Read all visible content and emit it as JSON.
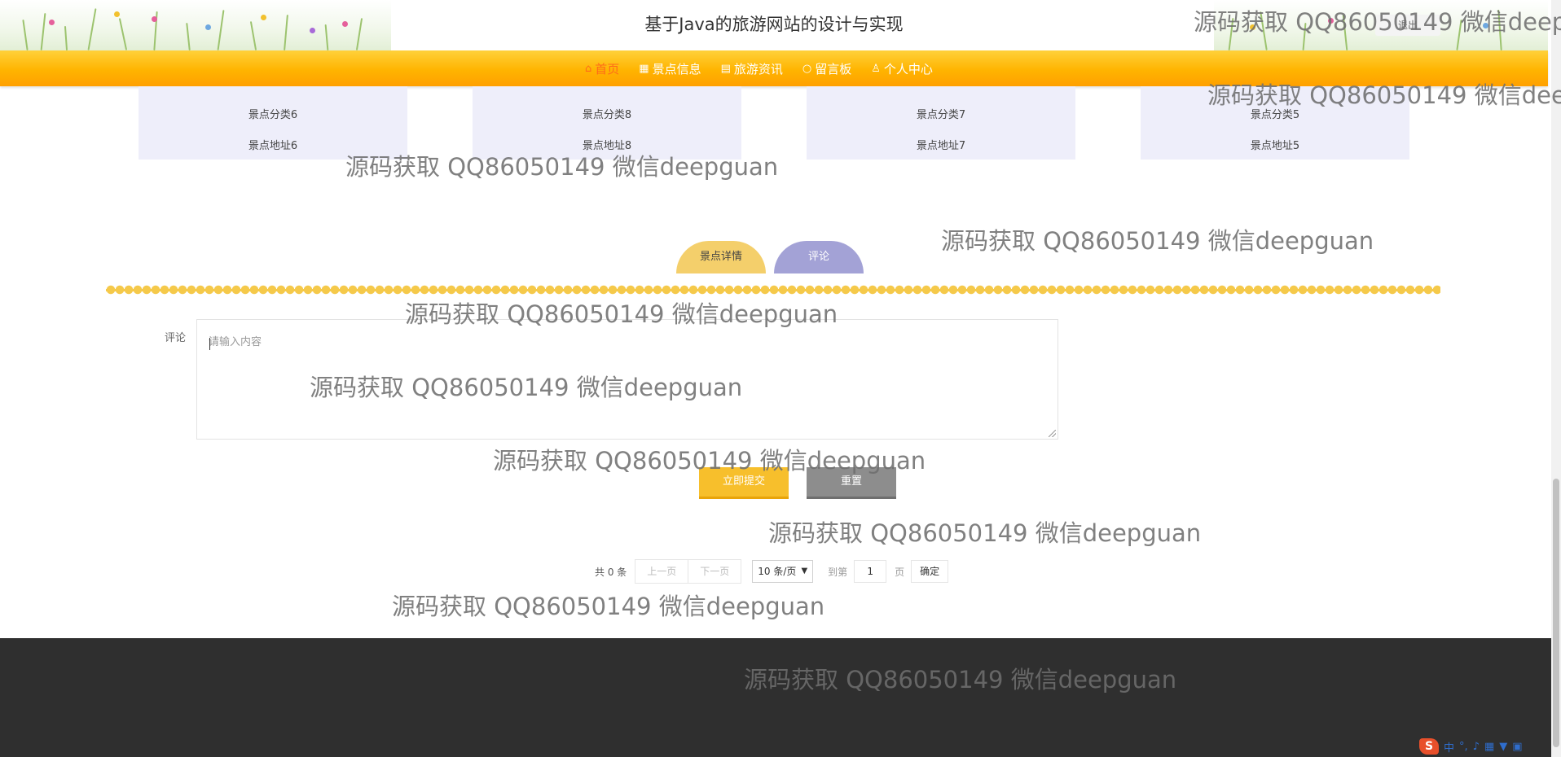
{
  "header": {
    "title": "基于Java的旅游网站的设计与实现",
    "logout_label": "退出"
  },
  "nav": {
    "items": [
      {
        "label": "首页",
        "icon": "home-icon",
        "active": true
      },
      {
        "label": "景点信息",
        "icon": "grid-icon",
        "active": false
      },
      {
        "label": "旅游资讯",
        "icon": "news-icon",
        "active": false
      },
      {
        "label": "留言板",
        "icon": "chat-icon",
        "active": false
      },
      {
        "label": "个人中心",
        "icon": "user-icon",
        "active": false
      }
    ]
  },
  "cards": [
    {
      "category": "景点分类6",
      "address": "景点地址6"
    },
    {
      "category": "景点分类8",
      "address": "景点地址8"
    },
    {
      "category": "景点分类7",
      "address": "景点地址7"
    },
    {
      "category": "景点分类5",
      "address": "景点地址5"
    }
  ],
  "tabs": {
    "detail_label": "景点详情",
    "comment_label": "评论"
  },
  "form": {
    "label": "评论",
    "placeholder": "请输入内容",
    "submit_label": "立即提交",
    "reset_label": "重置"
  },
  "pager": {
    "total_text": "共 0 条",
    "prev_label": "上一页",
    "next_label": "下一页",
    "page_size": "10 条/页",
    "goto_prefix": "到第",
    "page_value": "1",
    "page_unit": "页",
    "confirm_label": "确定"
  },
  "watermark": {
    "text": "源码获取 QQ86050149 微信deepguan"
  },
  "tray": {
    "logo": "S",
    "lang": "中",
    "punct": "°,",
    "icons": [
      "microphone-icon",
      "keyboard-icon",
      "shirt-icon",
      "apps-icon"
    ]
  },
  "colors": {
    "nav": "#ffb400",
    "active_nav": "#ff6a1a",
    "tab_detail": "#f4cf6b",
    "tab_comment": "#a3a2d6",
    "submit": "#f7bf2c",
    "reset": "#8d8d8d",
    "footer": "#2f2f2f"
  }
}
